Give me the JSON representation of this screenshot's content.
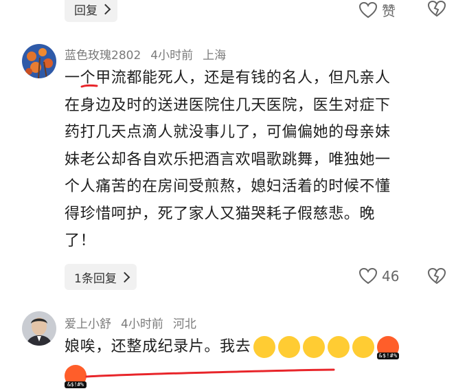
{
  "top": {
    "reply_label": "回复",
    "like_label": "赞"
  },
  "comment1": {
    "user": "蓝色玫瑰2802",
    "time": "4小时前",
    "location": "上海",
    "lines": [
      "一个甲流都能死人，还是有钱的名人，但凡亲人",
      "在身边及时的送进医院住几天医院，医生对症下",
      "药打几天点滴人就没事儿了，可偏偏她的母亲妹",
      "妹老公却各自欢乐把酒言欢唱歌跳舞，唯独她一",
      "个人痛苦的在房间受煎熬，媳妇活着的时候不懂",
      "得珍惜呵护，死了家人又猫哭耗子假慈悲。晚",
      "了！"
    ],
    "replies_label": "1条回复",
    "like_count": "46"
  },
  "comment2": {
    "user": "爱上小舒",
    "time": "4小时前",
    "location": "河北",
    "text": "娘唉，还整成纪录片。我去",
    "emoji_symbol": "&$!#%"
  },
  "colors": {
    "annotation_red": "#e8252a",
    "meta_gray": "#7a7a7a",
    "pill_bg": "#f1f1f1"
  }
}
